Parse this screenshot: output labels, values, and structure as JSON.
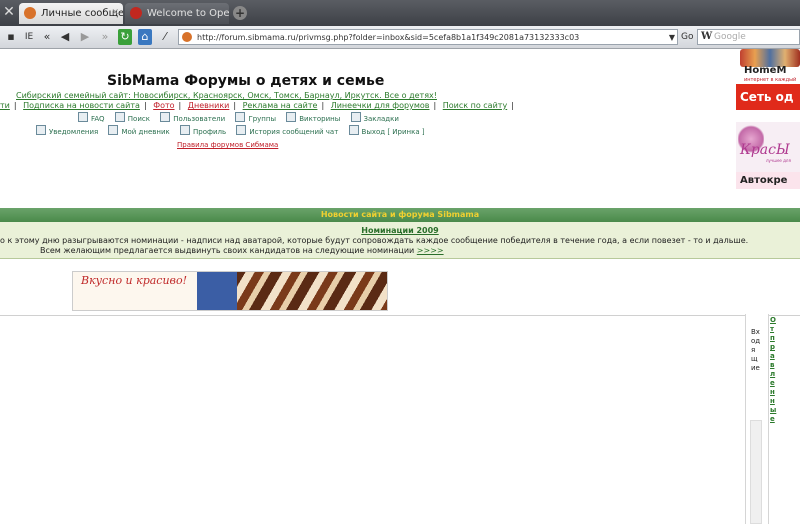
{
  "browser": {
    "tabs": [
      {
        "label": "Личные сообщения ..."
      },
      {
        "label": "Welcome to Opera"
      }
    ],
    "address": "http://forum.sibmama.ru/privmsg.php?folder=inbox&sid=5cefa8b1a1f349c2081a73132333c03",
    "go_label": "Go",
    "search_placeholder": "Google",
    "search_engine_glyph": "W"
  },
  "header": {
    "title": "SibMama Форумы о детях и семье",
    "tagline": "Сибирский семейный сайт: Новосибирск, Красноярск, Омск, Томск, Барнаул, Иркутск. Все о детях!",
    "nav_links": [
      {
        "label": "ти",
        "red": false
      },
      {
        "label": "Подписка на новости сайта",
        "red": false
      },
      {
        "label": "Фото",
        "red": true
      },
      {
        "label": "Дневники",
        "red": true
      },
      {
        "label": "Реклама на сайте",
        "red": false
      },
      {
        "label": "Линеечки для форумов",
        "red": false
      },
      {
        "label": "Поиск по сайту",
        "red": false
      }
    ],
    "icon_row_1": [
      {
        "label": "FAQ",
        "icon": "faq-icon"
      },
      {
        "label": "Поиск",
        "icon": "search-icon"
      },
      {
        "label": "Пользователи",
        "icon": "users-icon"
      },
      {
        "label": "Группы",
        "icon": "groups-icon"
      },
      {
        "label": "Викторины",
        "icon": "quiz-icon"
      },
      {
        "label": "Закладки",
        "icon": "bookmarks-icon"
      }
    ],
    "icon_row_2": [
      {
        "label": "Уведомления",
        "icon": "notifications-icon"
      },
      {
        "label": "Мой дневник",
        "icon": "diary-icon"
      },
      {
        "label": "Профиль",
        "icon": "profile-icon"
      },
      {
        "label": "История сообщений чат",
        "icon": "chat-history-icon"
      },
      {
        "label": "Выход [ Иринка ]",
        "icon": "logout-icon"
      }
    ],
    "rules_link": "Правила форумов Сибмама"
  },
  "ads": {
    "homeme_brand": "HomeM",
    "homeme_small": "интернет в каждый",
    "homeme_red": "Сеть од",
    "kras_script": "КрасЫ",
    "kras_sub": "лучшее для",
    "kras_bottom": "Автокре"
  },
  "news": {
    "bar_title": "Новости сайта и форума Sibmama",
    "item_title": "Номинации 2009",
    "line1": "о к этому дню разыгрываются номинации - надписи над аватарой, которые будут сопровождать каждое сообщение победителя в течение года, а если повезет - то и дальше.",
    "line2": "Всем желающим предлагается выдвинуть своих кандидатов на следующие номинации",
    "more_link": ">>>>"
  },
  "banner": {
    "text": "Вкусно и красиво!"
  },
  "side": {
    "right_vertical": "Входящие",
    "far_vertical": "Отправленные"
  }
}
